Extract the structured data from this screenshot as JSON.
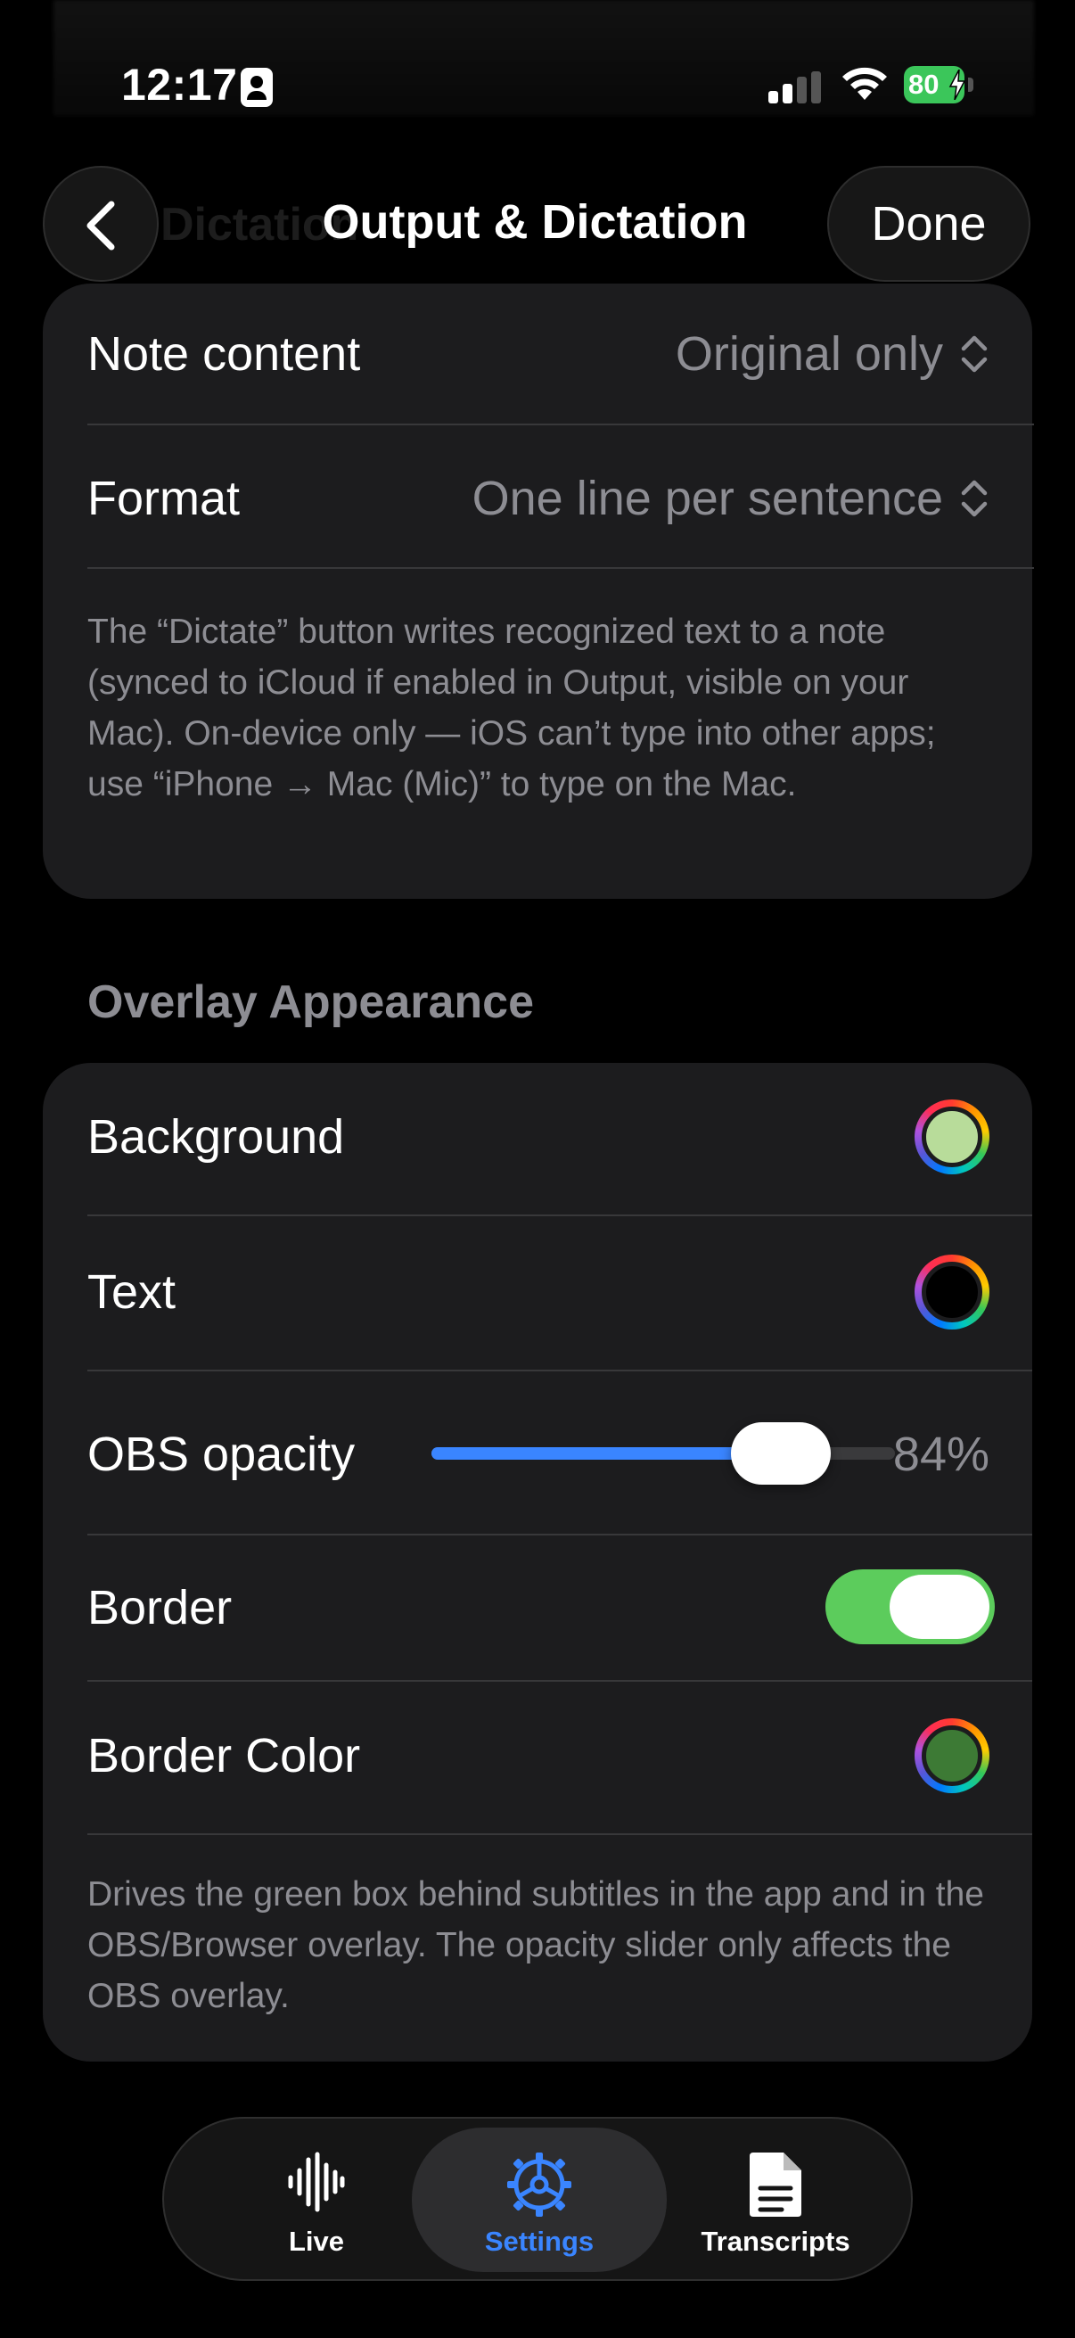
{
  "status_bar": {
    "time": "12:17",
    "battery": "80"
  },
  "nav": {
    "ghost_title": "Dictation",
    "title": "Output & Dictation",
    "done_label": "Done"
  },
  "dictation_card": {
    "note_content_label": "Note content",
    "note_content_value": "Original only",
    "format_label": "Format",
    "format_value": "One line per sentence",
    "footnote": "The “Dictate” button writes recognized text to a note (synced to iCloud if enabled in Output, visible on your Mac). On-device only — iOS can’t type into other apps; use “iPhone → Mac (Mic)” to type on the Mac."
  },
  "overlay_section": {
    "header": "Overlay Appearance",
    "background_label": "Background",
    "background_color": "#b8dc9a",
    "text_label": "Text",
    "text_color": "#000000",
    "opacity_label": "OBS opacity",
    "opacity_value": 84,
    "opacity_text": "84%",
    "border_label": "Border",
    "border_enabled": true,
    "border_color_label": "Border Color",
    "border_color": "#3d7a35",
    "footnote": "Drives the green box behind subtitles in the app and in the OBS/Browser overlay. The opacity slider only affects the OBS overlay."
  },
  "tabbar": {
    "tabs": [
      {
        "label": "Live",
        "icon": "waveform-icon"
      },
      {
        "label": "Settings",
        "icon": "gear-icon"
      },
      {
        "label": "Transcripts",
        "icon": "document-icon"
      }
    ],
    "active_color": "#3a85ff"
  }
}
